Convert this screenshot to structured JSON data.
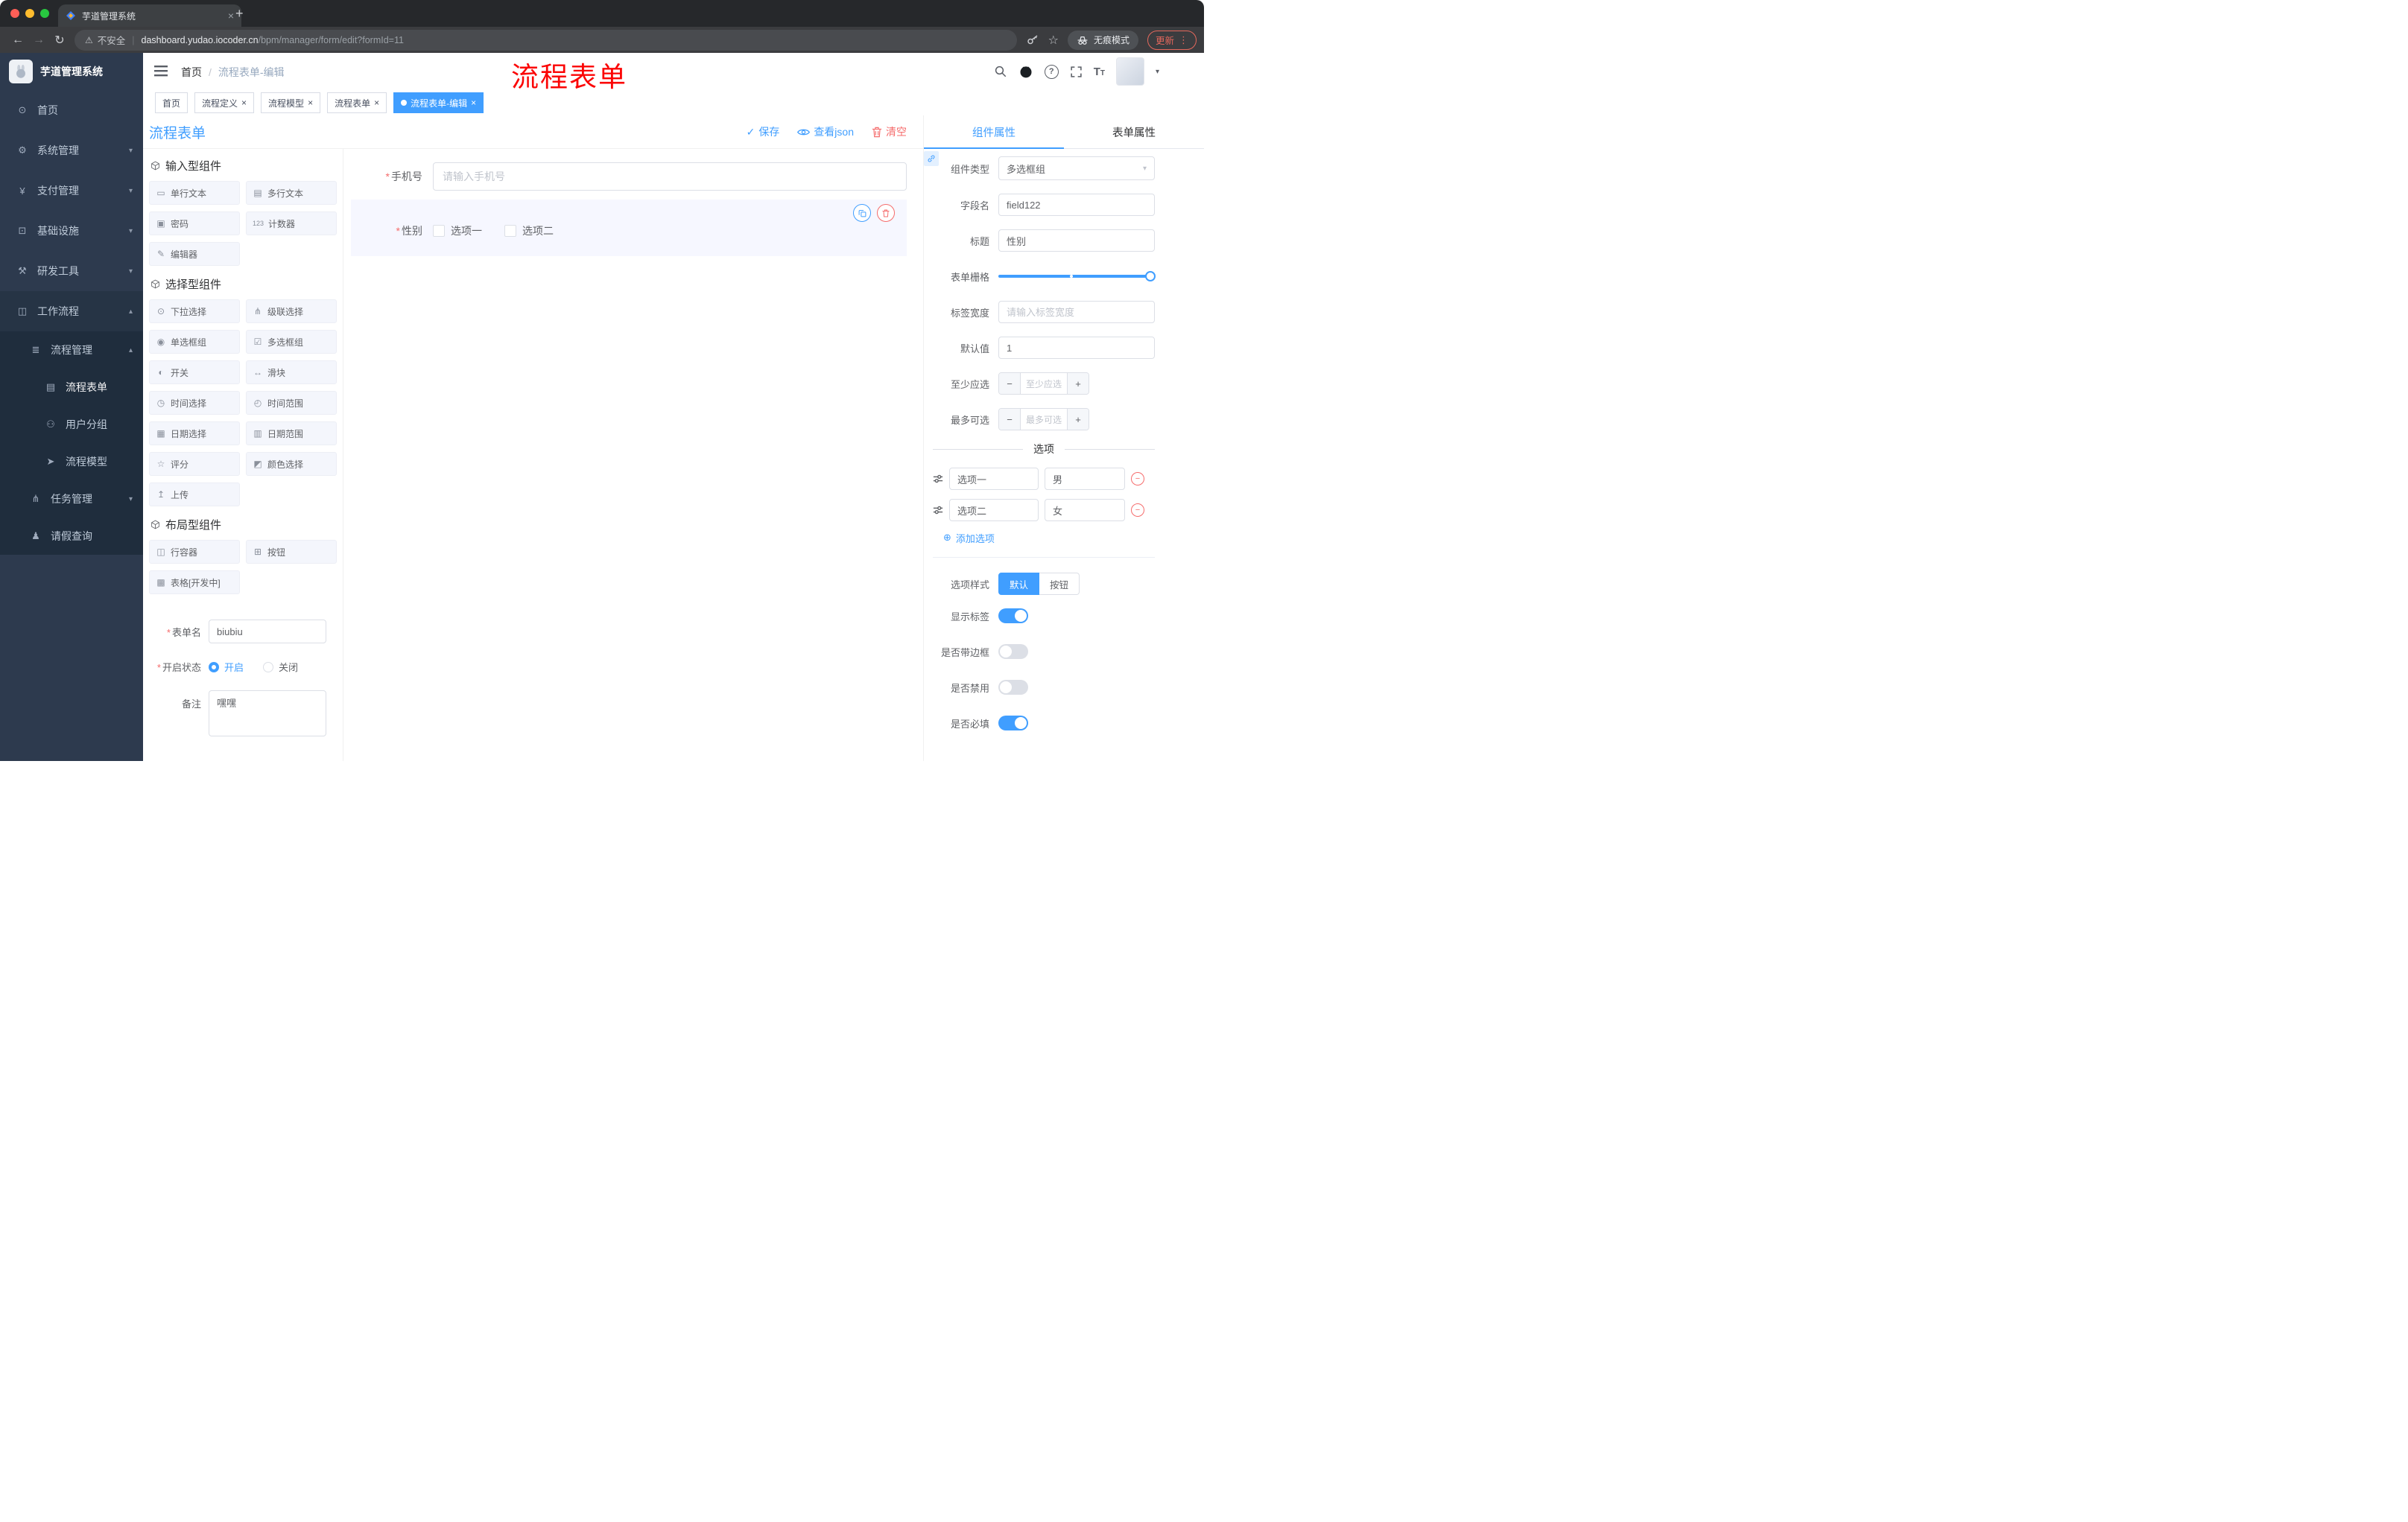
{
  "colors": {
    "accent": "#409eff",
    "danger": "#f56c6c",
    "annotation_red": "#fb0505",
    "sidebar_bg": "#2d3a4e",
    "active_tag_bg": "#409eff"
  },
  "glyphs": {
    "close": "×",
    "plus": "+",
    "kebab": "⋮",
    "caret_down": "▾",
    "caret_up": "▴",
    "check": "✓",
    "circle_plus": "⊕",
    "minus": "−",
    "back": "←",
    "forward": "→",
    "reload": "↻",
    "star": "☆",
    "warning": "⚠",
    "sep": "|",
    "question": "?",
    "font_large": "T",
    "font_small": "T"
  },
  "browser": {
    "tab_title": "芋道管理系统",
    "security": "不安全",
    "url_host": "dashboard.yudao.iocoder.cn",
    "url_path": "/bpm/manager/form/edit?formId=11",
    "incognito": "无痕模式",
    "update": "更新"
  },
  "sidebar": {
    "logo_title": "芋道管理系统",
    "items": [
      {
        "label": "首页",
        "glyph": "⊙"
      },
      {
        "label": "系统管理",
        "glyph": "⚙",
        "chevron": "▾"
      },
      {
        "label": "支付管理",
        "glyph": "¥",
        "chevron": "▾"
      },
      {
        "label": "基础设施",
        "glyph": "⊡",
        "chevron": "▾"
      },
      {
        "label": "研发工具",
        "glyph": "⚒",
        "chevron": "▾"
      },
      {
        "label": "工作流程",
        "glyph": "◫",
        "chevron": "▴"
      },
      {
        "label": "流程管理",
        "glyph": "≣",
        "chevron": "▴"
      },
      {
        "label": "流程表单",
        "glyph": "▤"
      },
      {
        "label": "用户分组",
        "glyph": "⚇"
      },
      {
        "label": "流程模型",
        "glyph": "➤"
      },
      {
        "label": "任务管理",
        "glyph": "⋔",
        "chevron": "▾"
      },
      {
        "label": "请假查询",
        "glyph": "♟"
      }
    ]
  },
  "navbar": {
    "breadcrumb_home": "首页",
    "breadcrumb_sep": "/",
    "breadcrumb_current": "流程表单-编辑"
  },
  "annotation": "流程表单",
  "tags": [
    {
      "label": "首页"
    },
    {
      "label": "流程定义"
    },
    {
      "label": "流程模型"
    },
    {
      "label": "流程表单"
    },
    {
      "label": "流程表单-编辑"
    }
  ],
  "designer": {
    "title": "流程表单",
    "save": "保存",
    "view_json": "查看json",
    "clear": "清空",
    "palette": {
      "sections": [
        {
          "title": "输入型组件",
          "items": [
            {
              "label": "单行文本",
              "glyph": "▭"
            },
            {
              "label": "多行文本",
              "glyph": "▤"
            },
            {
              "label": "密码",
              "glyph": "▣"
            },
            {
              "label": "计数器",
              "glyph": "123"
            },
            {
              "label": "编辑器",
              "glyph": "✎"
            }
          ]
        },
        {
          "title": "选择型组件",
          "items": [
            {
              "label": "下拉选择",
              "glyph": "⊙"
            },
            {
              "label": "级联选择",
              "glyph": "⋔"
            },
            {
              "label": "单选框组",
              "glyph": "◉"
            },
            {
              "label": "多选框组",
              "glyph": "☑"
            },
            {
              "label": "开关",
              "glyph": "◐"
            },
            {
              "label": "滑块",
              "glyph": "↔"
            },
            {
              "label": "时间选择",
              "glyph": "◷"
            },
            {
              "label": "时间范围",
              "glyph": "◴"
            },
            {
              "label": "日期选择",
              "glyph": "▦"
            },
            {
              "label": "日期范围",
              "glyph": "▥"
            },
            {
              "label": "评分",
              "glyph": "☆"
            },
            {
              "label": "颜色选择",
              "glyph": "◩"
            },
            {
              "label": "上传",
              "glyph": "↥"
            }
          ]
        },
        {
          "title": "布局型组件",
          "items": [
            {
              "label": "行容器",
              "glyph": "◫"
            },
            {
              "label": "按钮",
              "glyph": "⊞"
            },
            {
              "label": "表格[开发中]",
              "glyph": "▩"
            }
          ]
        }
      ]
    },
    "meta": {
      "form_name_label": "表单名",
      "form_name_value": "biubiu",
      "status_label": "开启状态",
      "status_on": "开启",
      "status_off": "关闭",
      "remark_label": "备注",
      "remark_value": "嘿嘿"
    },
    "canvas": {
      "phone_label": "手机号",
      "phone_placeholder": "请输入手机号",
      "gender_label": "性别",
      "gender_opt1": "选项一",
      "gender_opt2": "选项二"
    }
  },
  "props": {
    "tab_component": "组件属性",
    "tab_form": "表单属性",
    "component_type_label": "组件类型",
    "component_type_value": "多选框组",
    "field_name_label": "字段名",
    "field_name_value": "field122",
    "title_label": "标题",
    "title_value": "性别",
    "grid_label": "表单栅格",
    "label_width_label": "标签宽度",
    "label_width_placeholder": "请输入标签宽度",
    "default_label": "默认值",
    "default_value": "1",
    "min_label": "至少应选",
    "min_placeholder": "至少应选",
    "max_label": "最多可选",
    "max_placeholder": "最多可选",
    "options_divider": "选项",
    "options": [
      {
        "label": "选项一",
        "value": "男"
      },
      {
        "label": "选项二",
        "value": "女"
      }
    ],
    "add_option": "添加选项",
    "style_label": "选项样式",
    "style_default": "默认",
    "style_button": "按钮",
    "switch_show_label": "显示标签",
    "switch_border": "是否带边框",
    "switch_disabled": "是否禁用",
    "switch_required": "是否必填"
  }
}
